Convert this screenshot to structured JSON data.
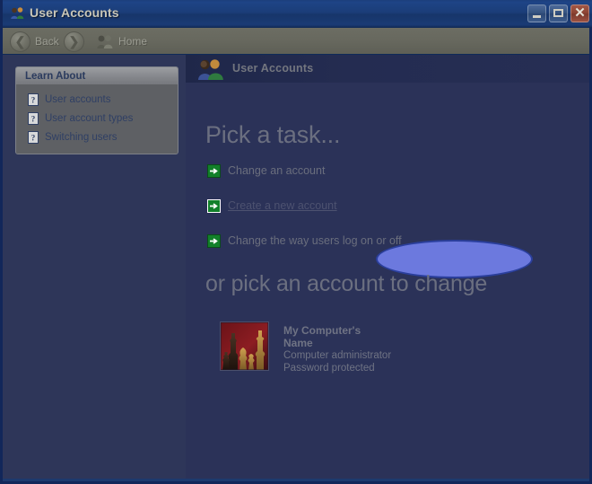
{
  "window": {
    "title": "User Accounts",
    "title_icon": "users-icon",
    "controls": {
      "minimize": "Minimize",
      "maximize": "Maximize",
      "close": "Close"
    }
  },
  "toolbar": {
    "back_label": "Back",
    "back_icon": "back-arrow-icon",
    "forward_icon": "forward-arrow-icon",
    "home_label": "Home",
    "home_icon": "users-icon"
  },
  "sidebar": {
    "panel_title": "Learn About",
    "items": [
      {
        "label": "User accounts",
        "icon": "help-topic-icon"
      },
      {
        "label": "User account types",
        "icon": "help-topic-icon"
      },
      {
        "label": "Switching users",
        "icon": "help-topic-icon"
      }
    ]
  },
  "banner": {
    "title": "User Accounts",
    "icon": "users-icon"
  },
  "main": {
    "heading_tasks": "Pick a task...",
    "heading_accounts": "or pick an account to change",
    "tasks": [
      {
        "label": "Change an account",
        "icon": "green-arrow-icon",
        "highlighted": false
      },
      {
        "label": "Create a new account",
        "icon": "green-arrow-icon",
        "highlighted": true
      },
      {
        "label": "Change the way users log on or off",
        "icon": "green-arrow-icon",
        "highlighted": false
      }
    ],
    "accounts": [
      {
        "name_line1": "My Computer's",
        "name_line2": "Name",
        "type": "Computer administrator",
        "password_status": "Password protected",
        "avatar": "chess-pieces-avatar"
      }
    ]
  },
  "colors": {
    "titlebar_blue": "#1b3d78",
    "content_navy": "#2b3258",
    "left_pane_navy": "#2e3659",
    "panel_gray": "#5e6064",
    "toolbar_gray": "#67685e",
    "heading_gray": "#6b6f80",
    "highlight_fill": "#6c79de",
    "highlight_border": "#2b3f9c",
    "green_arrow": "#12802a",
    "close_button_red": "#8e4433"
  }
}
